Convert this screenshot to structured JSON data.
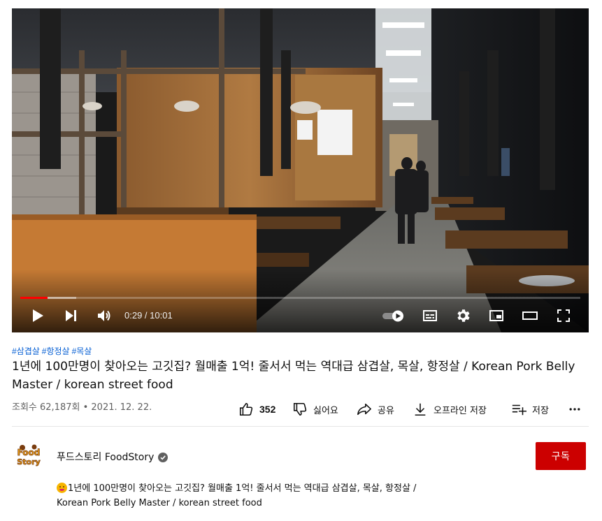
{
  "player": {
    "progress_fraction": 0.0483,
    "buffered_fraction": 0.1,
    "time_current": "0:29",
    "time_total": "10:01",
    "time_sep": " / "
  },
  "video": {
    "hashtags": [
      "#삼겹살",
      "#항정살",
      "#목살"
    ],
    "title": "1년에 100만명이 찾아오는 고깃집? 월매출 1억! 줄서서 먹는 역대급 삼겹살, 목살, 항정살 / Korean Pork Belly Master / korean street food",
    "views": "조회수 62,187회",
    "date": "2021. 12. 22.",
    "meta_sep": " • "
  },
  "actions": {
    "like_count": "352",
    "dislike_label": "싫어요",
    "share_label": "공유",
    "offline_label": "오프라인 저장",
    "save_label": "저장"
  },
  "channel": {
    "name": "푸드스토리 FoodStory",
    "avatar_text_line1": "Food",
    "avatar_text_line2": "Story",
    "subscribe_label": "구독"
  },
  "description": {
    "line1": "1년에 100만명이 찾아오는 고깃집? 월매출 1억! 줄서서 먹는 역대급 삼겹살, 목살, 항정살 /",
    "line2": "Korean Pork Belly Master / korean street food"
  },
  "colors": {
    "accent_red": "#ff0000",
    "subscribe_bg": "#cc0000",
    "hashtag_blue": "#065fd4",
    "secondary_text": "#606060"
  }
}
